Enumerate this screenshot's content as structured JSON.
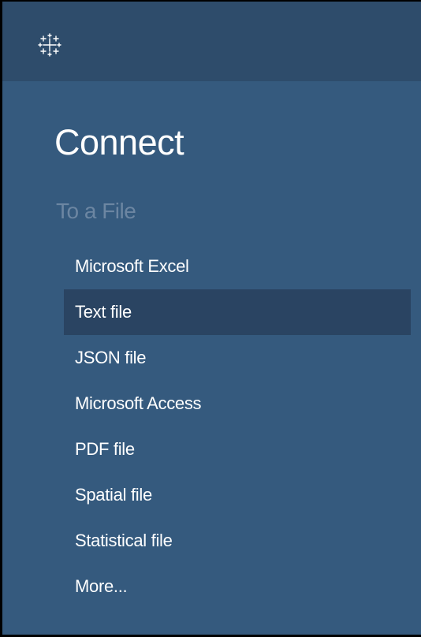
{
  "logo": {
    "icon": "tableau-logo-icon"
  },
  "heading": "Connect",
  "section_title": "To a File",
  "file_types": [
    {
      "label": "Microsoft Excel",
      "selected": false
    },
    {
      "label": "Text file",
      "selected": true
    },
    {
      "label": "JSON file",
      "selected": false
    },
    {
      "label": "Microsoft Access",
      "selected": false
    },
    {
      "label": "PDF file",
      "selected": false
    },
    {
      "label": "Spatial file",
      "selected": false
    },
    {
      "label": "Statistical file",
      "selected": false
    },
    {
      "label": "More...",
      "selected": false
    }
  ],
  "colors": {
    "panel_background": "#355a7e",
    "topbar_background": "#2e4c6b",
    "selected_item_background": "#2a4462",
    "section_title": "#6c86a2",
    "text": "#ffffff"
  }
}
